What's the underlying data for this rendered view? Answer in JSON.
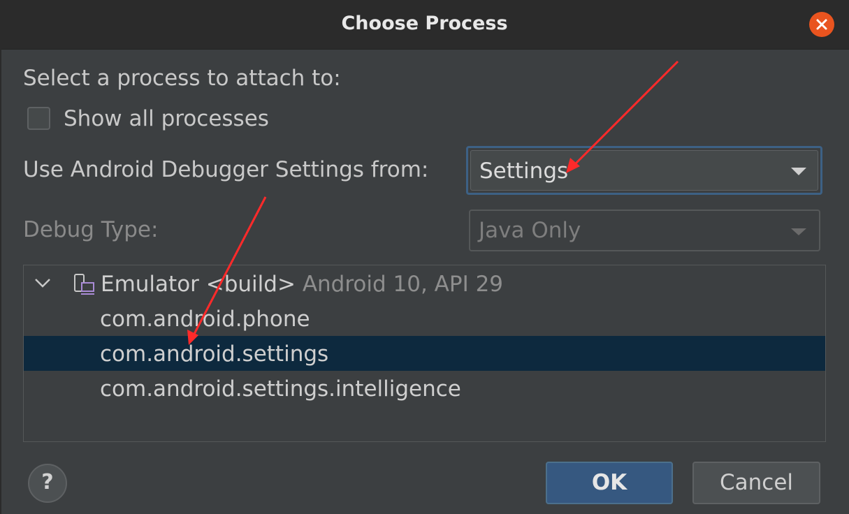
{
  "dialog": {
    "title": "Choose Process",
    "prompt": "Select a process to attach to:",
    "show_all_processes": {
      "label": "Show all processes",
      "checked": false
    },
    "debugger_settings": {
      "label": "Use Android Debugger Settings from:",
      "value": "Settings"
    },
    "debug_type": {
      "label": "Debug Type:",
      "value": "Java Only",
      "enabled": false
    },
    "process_tree": {
      "device": {
        "name": "Emulator <build>",
        "detail": "Android 10, API 29",
        "expanded": true
      },
      "processes": [
        {
          "name": "com.android.phone",
          "selected": false
        },
        {
          "name": "com.android.settings",
          "selected": true
        },
        {
          "name": "com.android.settings.intelligence",
          "selected": false
        }
      ]
    },
    "buttons": {
      "help": "?",
      "ok": "OK",
      "cancel": "Cancel"
    }
  },
  "colors": {
    "background": "#3c3f41",
    "titlebar": "#2b2b2b",
    "close_button": "#e9541f",
    "selection": "#0d293e",
    "ok_button": "#365880",
    "focus_border": "#3d6185",
    "annotation_arrow": "#ff2a2a"
  },
  "icons": {
    "close": "close-icon",
    "expand": "chevron-down-icon",
    "device": "emulator-device-icon",
    "help": "help-icon"
  }
}
